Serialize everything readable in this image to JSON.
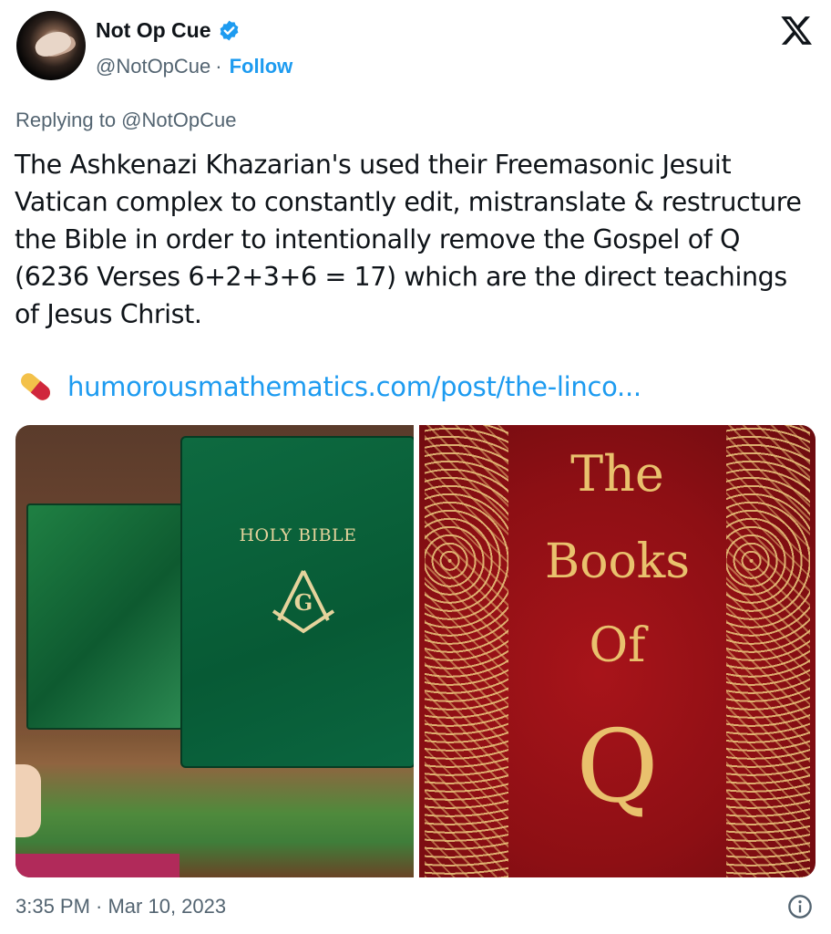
{
  "author": {
    "name": "Not Op Cue",
    "handle": "@NotOpCue",
    "separator": "·",
    "follow_label": "Follow"
  },
  "reply_to": "Replying to @NotOpCue",
  "tweet_text": "The Ashkenazi Khazarian's used their Freemasonic Jesuit Vatican complex to constantly edit, mistranslate & restructure the Bible in order to intentionally remove the Gospel of Q (6236 Verses 6+2+3+6 = 17) which are the direct teachings of Jesus Christ.",
  "link": {
    "emoji": "pill-icon",
    "text": "humorousmathematics.com/post/the-linco..."
  },
  "media": {
    "left_image": {
      "book_title": "HOLY BIBLE",
      "emblem_letter": "G"
    },
    "right_image": {
      "line1": "The",
      "line2": "Books",
      "line3": "Of",
      "line4": "Q"
    }
  },
  "timestamp": "3:35 PM · Mar 10, 2023",
  "icons": [
    "verified-badge-icon",
    "x-logo-icon",
    "pill-icon",
    "info-icon"
  ],
  "colors": {
    "accent": "#1d9bf0",
    "secondary_text": "#536471",
    "primary_text": "#0f1419"
  }
}
